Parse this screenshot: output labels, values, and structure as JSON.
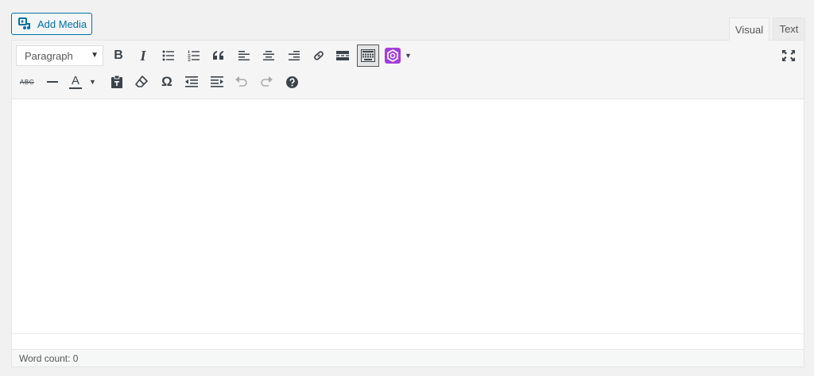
{
  "add_media": {
    "label": "Add Media",
    "icon": "add-media-icon"
  },
  "tabs": [
    {
      "label": "Visual",
      "active": true
    },
    {
      "label": "Text",
      "active": false
    }
  ],
  "toolbar": {
    "format_select": {
      "value": "Paragraph"
    },
    "row1_icons": [
      "bold-icon",
      "italic-icon",
      "bulleted-list-icon",
      "numbered-list-icon",
      "blockquote-icon",
      "align-left-icon",
      "align-center-icon",
      "align-right-icon",
      "link-icon",
      "read-more-icon",
      "toolbar-toggle-icon",
      "plugin-icon",
      "fullscreen-icon"
    ],
    "row2_icons": [
      "strikethrough-icon",
      "horizontal-line-icon",
      "text-color-icon",
      "paste-as-text-icon",
      "clear-formatting-icon",
      "special-character-icon",
      "outdent-icon",
      "indent-icon",
      "undo-icon",
      "redo-icon",
      "help-icon"
    ],
    "text_color_glyph": "A",
    "omega_glyph": "Ω",
    "bold_glyph": "B",
    "italic_glyph": "I",
    "strike_glyph": "ABC",
    "accent_color": "#0071a1",
    "plugin_color": "#a23fd8"
  },
  "status_bar": {
    "word_count": "Word count: 0"
  }
}
